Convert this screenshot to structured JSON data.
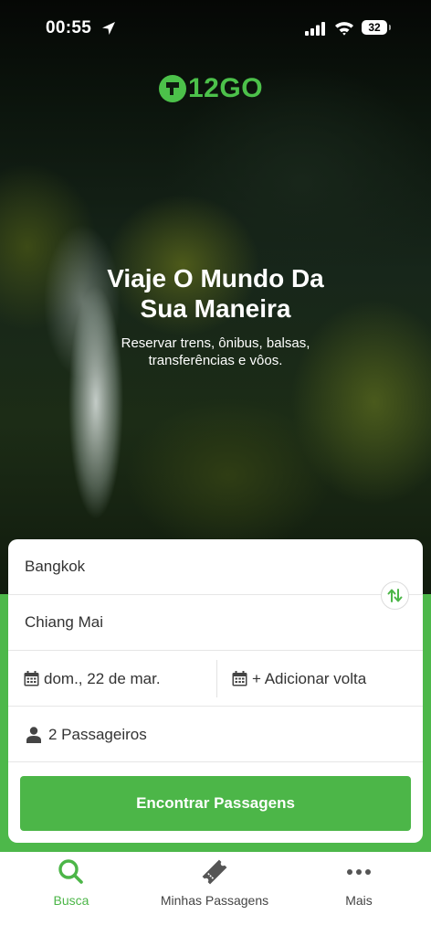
{
  "status_bar": {
    "time": "00:55",
    "battery": "32",
    "icons": [
      "location-arrow-icon",
      "signal-icon",
      "wifi-icon",
      "battery-icon"
    ]
  },
  "brand": {
    "logo_text": "12GO",
    "color": "#4cc14a"
  },
  "hero": {
    "title_line1": "Viaje O Mundo Da",
    "title_line2": "Sua Maneira",
    "subtitle_line1": "Reservar trens, ônibus, balsas,",
    "subtitle_line2": "transferências e vôos."
  },
  "search_form": {
    "from": "Bangkok",
    "to": "Chiang Mai",
    "departure_date": "dom., 22 de mar.",
    "return_date": "+ Adicionar volta",
    "passengers": "2 Passageiros",
    "submit_label": "Encontrar Passagens",
    "icons": [
      "swap-icon",
      "calendar-icon",
      "person-icon"
    ]
  },
  "tab_bar": {
    "items": [
      {
        "label": "Busca",
        "icon": "search-icon",
        "active": true
      },
      {
        "label": "Minhas Passagens",
        "icon": "ticket-icon",
        "active": false
      },
      {
        "label": "Mais",
        "icon": "more-icon",
        "active": false
      }
    ]
  },
  "colors": {
    "accent": "#4cb648",
    "text": "#333333"
  }
}
